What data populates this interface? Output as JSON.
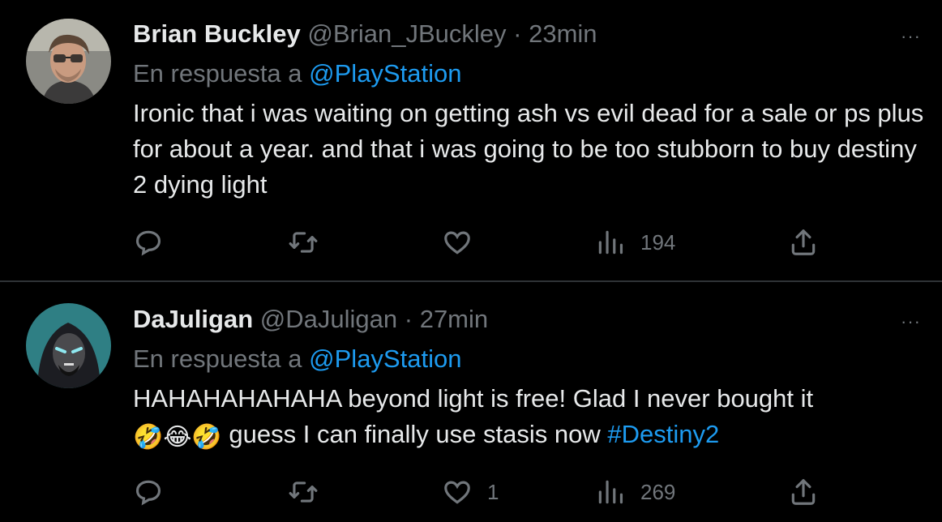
{
  "tweets": [
    {
      "name": "Brian Buckley",
      "handle": "@Brian_JBuckley",
      "separator": "·",
      "time": "23min",
      "reply_prefix": "En respuesta a",
      "reply_to": "@PlayStation",
      "body_text": "Ironic that i was waiting on getting ash vs evil dead for a sale or ps plus for about a year. and that i was going to be too stubborn to buy destiny 2 dying light",
      "likes": "",
      "views": "194",
      "more_label": "···"
    },
    {
      "name": "DaJuligan",
      "handle": "@DaJuligan",
      "separator": "·",
      "time": "27min",
      "reply_prefix": "En respuesta a",
      "reply_to": "@PlayStation",
      "body_line1": "HAHAHAHAHAHA beyond light is free! Glad I never bought it",
      "emojis": [
        "🤣",
        "😂",
        "🤣"
      ],
      "body_line2": "guess I can finally use stasis now",
      "hashtag": "#Destiny2",
      "likes": "1",
      "views": "269",
      "more_label": "···"
    }
  ],
  "colors": {
    "background": "#000000",
    "text": "#e7e9ea",
    "muted": "#71767b",
    "accent": "#1d9bf0",
    "divider": "#2f3336"
  },
  "icons": [
    "reply-icon",
    "retweet-icon",
    "like-icon",
    "views-icon",
    "share-icon",
    "more-icon"
  ]
}
